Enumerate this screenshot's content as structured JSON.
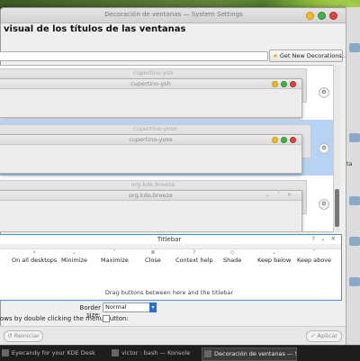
{
  "window": {
    "title": "Decoración de ventanas — System Settings",
    "heading": "visual de los títulos de las ventanas"
  },
  "toolbar": {
    "get_new_label": "Get New Decorations..."
  },
  "decorations": [
    {
      "back_title": "cupertino-ysh",
      "front_title": "cupertino-ysh",
      "selected": false
    },
    {
      "back_title": "cupertino-yose",
      "front_title": "cupertino-yose",
      "selected": true
    },
    {
      "back_title": "org.kde.breeze",
      "front_title": "org.kde.breeze",
      "selected": false
    }
  ],
  "titlebar_editor": {
    "title": "Titlebar",
    "window_controls": "? ⌄ ✕",
    "buttons": [
      {
        "label": "On all desktops",
        "icon": "pin-icon"
      },
      {
        "label": "Minimize",
        "icon": "minimize-icon"
      },
      {
        "label": "Maximize",
        "icon": "maximize-icon"
      },
      {
        "label": "Close",
        "icon": "close-icon"
      },
      {
        "label": "Context help",
        "icon": "help-icon"
      },
      {
        "label": "Shade",
        "icon": "shade-icon"
      },
      {
        "label": "Keep below",
        "icon": "keep-below-icon"
      },
      {
        "label": "Keep above",
        "icon": "keep-above-icon"
      }
    ],
    "hint": "Drag buttons between here and the titlebar"
  },
  "border_size": {
    "label": "Border size:",
    "value": "Normal"
  },
  "close_option": {
    "label": "ows by double clicking the menu button:",
    "checked": false
  },
  "footer": {
    "reset_label": "Reiniciar",
    "apply_label": "Aplicar"
  },
  "side_panel": {
    "text": "ta"
  },
  "taskbar": {
    "items": [
      {
        "label": "Eyecandy for your KDE Desk",
        "active": false
      },
      {
        "label": "victor : bash — Konsole",
        "active": false
      },
      {
        "label": "Decoración de ventanas — S",
        "active": true
      }
    ]
  },
  "colors": {
    "selection": "#b6d3f3",
    "accent": "#2a6fcf",
    "close_red": "#e0443c",
    "minimize_yellow": "#f0b92a",
    "maximize_green": "#3fb548"
  }
}
